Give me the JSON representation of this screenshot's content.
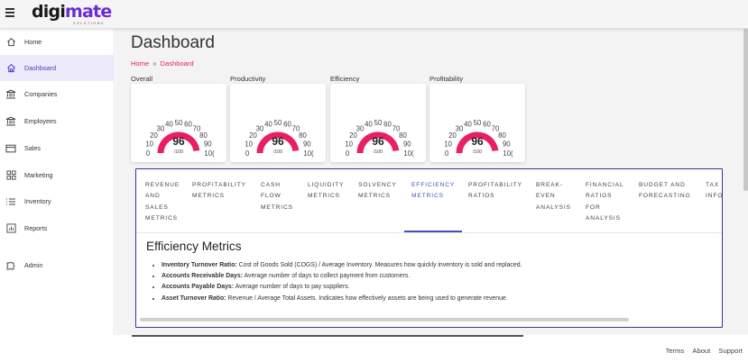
{
  "brand": {
    "logo_main": "digi",
    "logo_accent": "mate",
    "logo_sub": "SOLUTIONS",
    "accent_color": "#6a2bd8"
  },
  "topbar": {
    "menu_icon": "hamburger-icon"
  },
  "sidebar": {
    "items": [
      {
        "label": "Home",
        "icon": "home-icon",
        "active": false
      },
      {
        "label": "Dashboard",
        "icon": "dashboard-home-icon",
        "active": true
      },
      {
        "label": "Companies",
        "icon": "bank-icon",
        "active": false
      },
      {
        "label": "Employees",
        "icon": "bank-icon",
        "active": false
      },
      {
        "label": "Sales",
        "icon": "card-icon",
        "active": false
      },
      {
        "label": "Marketing",
        "icon": "grid-icon",
        "active": false
      },
      {
        "label": "Inventory",
        "icon": "list-icon",
        "active": false
      },
      {
        "label": "Reports",
        "icon": "report-icon",
        "active": false
      },
      {
        "label": "Admin",
        "icon": "puzzle-icon",
        "active": false
      }
    ]
  },
  "page": {
    "title": "Dashboard",
    "breadcrumb": {
      "home": "Home",
      "sep": "»",
      "current": "Dashboard"
    }
  },
  "gauges": [
    {
      "label": "Overall",
      "value": 96,
      "denominator": "/100"
    },
    {
      "label": "Productivity",
      "value": 96,
      "denominator": "/100"
    },
    {
      "label": "Efficiency",
      "value": 96,
      "denominator": "/100"
    },
    {
      "label": "Profitability",
      "value": 96,
      "denominator": "/100"
    }
  ],
  "gauge_scale": {
    "ticks": [
      "0",
      "10",
      "20",
      "30",
      "40",
      "50",
      "60",
      "70",
      "80",
      "90",
      "10("
    ],
    "color": "#e91e63"
  },
  "metrics": {
    "tabs": [
      {
        "label": "REVENUE AND SALES METRICS",
        "lines": [
          "REVENUE",
          "AND",
          "SALES",
          "METRICS"
        ]
      },
      {
        "label": "PROFITABILITY METRICS",
        "lines": [
          "PROFITABILITY",
          "METRICS"
        ]
      },
      {
        "label": "CASH FLOW METRICS",
        "lines": [
          "CASH",
          "FLOW",
          "METRICS"
        ]
      },
      {
        "label": "LIQUIDITY METRICS",
        "lines": [
          "LIQUIDITY",
          "METRICS"
        ]
      },
      {
        "label": "SOLVENCY METRICS",
        "lines": [
          "SOLVENCY",
          "METRICS"
        ]
      },
      {
        "label": "EFFICIENCY METRICS",
        "lines": [
          "EFFICIENCY",
          "METRICS"
        ],
        "active": true
      },
      {
        "label": "PROFITABILITY RATIOS",
        "lines": [
          "PROFITABILITY",
          "RATIOS"
        ]
      },
      {
        "label": "BREAK-EVEN ANALYSIS",
        "lines": [
          "BREAK-",
          "EVEN",
          "ANALYSIS"
        ]
      },
      {
        "label": "FINANCIAL RATIOS FOR ANALYSIS",
        "lines": [
          "FINANCIAL",
          "RATIOS",
          "FOR",
          "ANALYSIS"
        ]
      },
      {
        "label": "BUDGET AND FORECASTING",
        "lines": [
          "BUDGET AND",
          "FORECASTING"
        ]
      },
      {
        "label": "TAX INFO",
        "lines": [
          "TAX",
          "INFO"
        ]
      }
    ],
    "content_title": "Efficiency Metrics",
    "items": [
      {
        "term": "Inventory Turnover Ratio:",
        "desc": " Cost of Goods Sold (COGS) / Average Inventory. Measures how quickly inventory is sold and replaced."
      },
      {
        "term": "Accounts Receivable Days:",
        "desc": " Average number of days to collect payment from customers."
      },
      {
        "term": "Accounts Payable Days:",
        "desc": " Average number of days to pay suppliers."
      },
      {
        "term": "Asset Turnover Ratio:",
        "desc": " Revenue / Average Total Assets. Indicates how effectively assets are being used to generate revenue."
      }
    ]
  },
  "footer": {
    "links": [
      "Terms",
      "About",
      "Support"
    ]
  }
}
